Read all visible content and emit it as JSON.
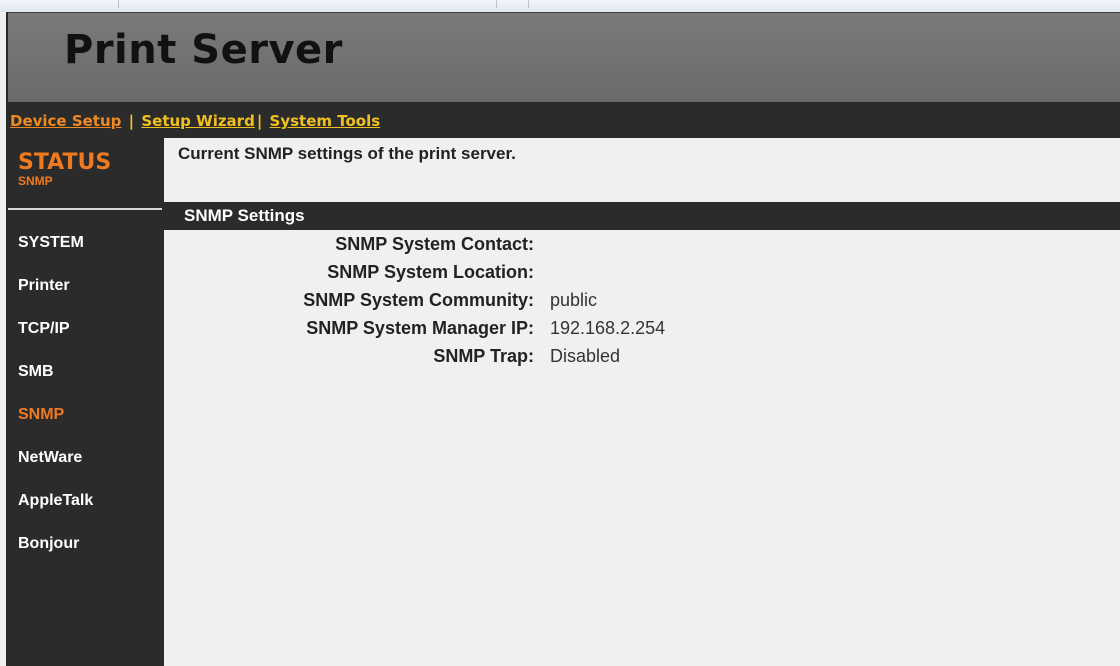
{
  "header": {
    "title": "Print Server"
  },
  "nav": {
    "device_setup": "Device Setup",
    "sep1": "|",
    "setup_wizard": "Setup Wizard",
    "sep2": "|",
    "system_tools": "System Tools"
  },
  "sidebar": {
    "status_title": "STATUS",
    "status_sub": "SNMP",
    "items": [
      {
        "label": "SYSTEM",
        "active": false
      },
      {
        "label": "Printer",
        "active": false
      },
      {
        "label": "TCP/IP",
        "active": false
      },
      {
        "label": "SMB",
        "active": false
      },
      {
        "label": "SNMP",
        "active": true
      },
      {
        "label": "NetWare",
        "active": false
      },
      {
        "label": "AppleTalk",
        "active": false
      },
      {
        "label": "Bonjour",
        "active": false
      }
    ]
  },
  "main": {
    "description": "Current SNMP settings of the print server.",
    "section_title": "SNMP Settings",
    "settings": [
      {
        "label": "SNMP System Contact:",
        "value": ""
      },
      {
        "label": "SNMP System Location:",
        "value": ""
      },
      {
        "label": "SNMP System Community:",
        "value": "public"
      },
      {
        "label": "SNMP System Manager IP:",
        "value": "192.168.2.254"
      },
      {
        "label": "SNMP Trap:",
        "value": "Disabled"
      }
    ]
  },
  "colors": {
    "accent_orange": "#f07a20",
    "link_yellow": "#f0c020",
    "dark_bar": "#2b2b2b",
    "banner_gray": "#737373",
    "content_bg": "#f0f0f0"
  }
}
